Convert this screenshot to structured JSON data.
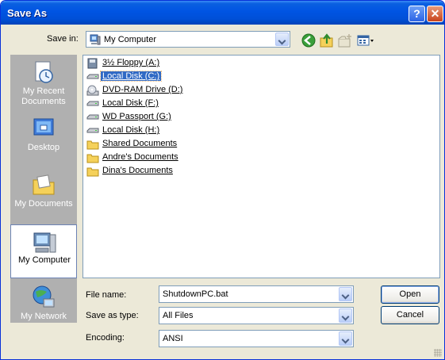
{
  "window": {
    "title": "Save As",
    "help_glyph": "?",
    "close_glyph": "✕"
  },
  "toolbar": {
    "save_in_label": "Save in:",
    "save_in_value": "My Computer",
    "icons": [
      "back-icon",
      "up-folder-icon",
      "new-folder-icon",
      "views-menu-icon"
    ]
  },
  "places": [
    {
      "label_line1": "My Recent",
      "label_line2": "Documents",
      "icon": "recent-documents-icon"
    },
    {
      "label_line1": "Desktop",
      "label_line2": "",
      "icon": "desktop-icon"
    },
    {
      "label_line1": "My Documents",
      "label_line2": "",
      "icon": "my-documents-icon"
    },
    {
      "label_line1": "My Computer",
      "label_line2": "",
      "icon": "my-computer-icon"
    },
    {
      "label_line1": "My Network",
      "label_line2": "",
      "icon": "my-network-icon"
    }
  ],
  "files": [
    {
      "name": "3½ Floppy (A:)",
      "icon": "floppy-icon"
    },
    {
      "name": "Local Disk (C:)",
      "icon": "drive-icon",
      "selected": true
    },
    {
      "name": "DVD-RAM Drive (D:)",
      "icon": "dvd-icon"
    },
    {
      "name": "Local Disk (F:)",
      "icon": "drive-icon"
    },
    {
      "name": "WD Passport (G:)",
      "icon": "drive-icon"
    },
    {
      "name": "Local Disk (H:)",
      "icon": "drive-icon"
    },
    {
      "name": "Shared Documents",
      "icon": "folder-icon"
    },
    {
      "name": "Andre's Documents",
      "icon": "folder-icon"
    },
    {
      "name": "Dina's Documents",
      "icon": "folder-icon"
    }
  ],
  "form": {
    "file_name_label": "File name:",
    "file_name_value": "ShutdownPC.bat",
    "save_as_type_label": "Save as type:",
    "save_as_type_value": "All Files",
    "encoding_label": "Encoding:",
    "encoding_value": "ANSI"
  },
  "buttons": {
    "open": "Open",
    "cancel": "Cancel"
  },
  "colors": {
    "titlebar": "#0054e3",
    "selection": "#316ac5",
    "places_bg": "#b0b0b0",
    "dialog_bg": "#ece9d8"
  }
}
